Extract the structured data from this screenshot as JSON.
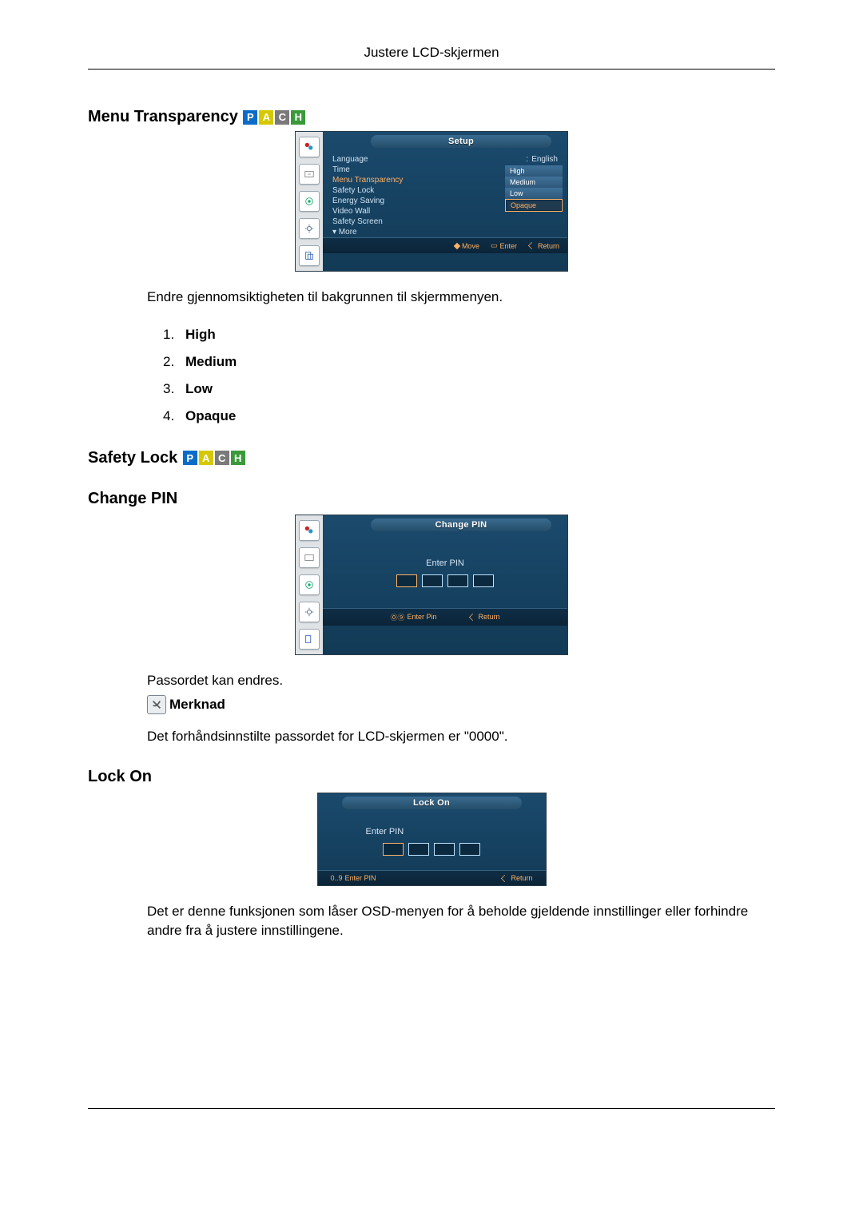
{
  "page_header": "Justere LCD-skjermen",
  "sections": {
    "menu_transparency": {
      "heading": "Menu Transparency",
      "badges": [
        "P",
        "A",
        "C",
        "H"
      ],
      "osd": {
        "title": "Setup",
        "rows": [
          {
            "label": "Language",
            "value": "English"
          },
          {
            "label": "Time",
            "value": ""
          },
          {
            "label": "Menu Transparency",
            "value": "High",
            "selected": true
          },
          {
            "label": "Safety Lock",
            "value": ""
          },
          {
            "label": "Energy Saving",
            "value": ""
          },
          {
            "label": "Video Wall",
            "value": ""
          },
          {
            "label": "Safety Screen",
            "value": ""
          },
          {
            "label": "▾ More",
            "value": ""
          }
        ],
        "popup": [
          "High",
          "Medium",
          "Low",
          "Opaque"
        ],
        "popup_selected": "Opaque",
        "footer": {
          "move": "Move",
          "enter": "Enter",
          "return": "Return"
        }
      },
      "desc": "Endre gjennomsiktigheten til bakgrunnen til skjermmenyen.",
      "list": [
        "High",
        "Medium",
        "Low",
        "Opaque"
      ]
    },
    "safety_lock": {
      "heading": "Safety Lock",
      "badges": [
        "P",
        "A",
        "C",
        "H"
      ]
    },
    "change_pin": {
      "heading": "Change PIN",
      "osd": {
        "title": "Change PIN",
        "label": "Enter PIN",
        "footer": {
          "enter": "Enter Pin",
          "return": "Return"
        }
      },
      "desc": "Passordet kan endres.",
      "note_label": "Merknad",
      "note_text": "Det forhåndsinnstilte passordet for LCD-skjermen er \"0000\"."
    },
    "lock_on": {
      "heading": "Lock On",
      "osd": {
        "title": "Lock On",
        "label": "Enter PIN",
        "footer": {
          "enter": "Enter PIN",
          "enter_prefix": "0..9",
          "return": "Return"
        }
      },
      "desc": "Det er denne funksjonen som låser OSD-menyen for å beholde gjeldende innstillinger eller forhindre andre fra å justere innstillingene."
    }
  }
}
